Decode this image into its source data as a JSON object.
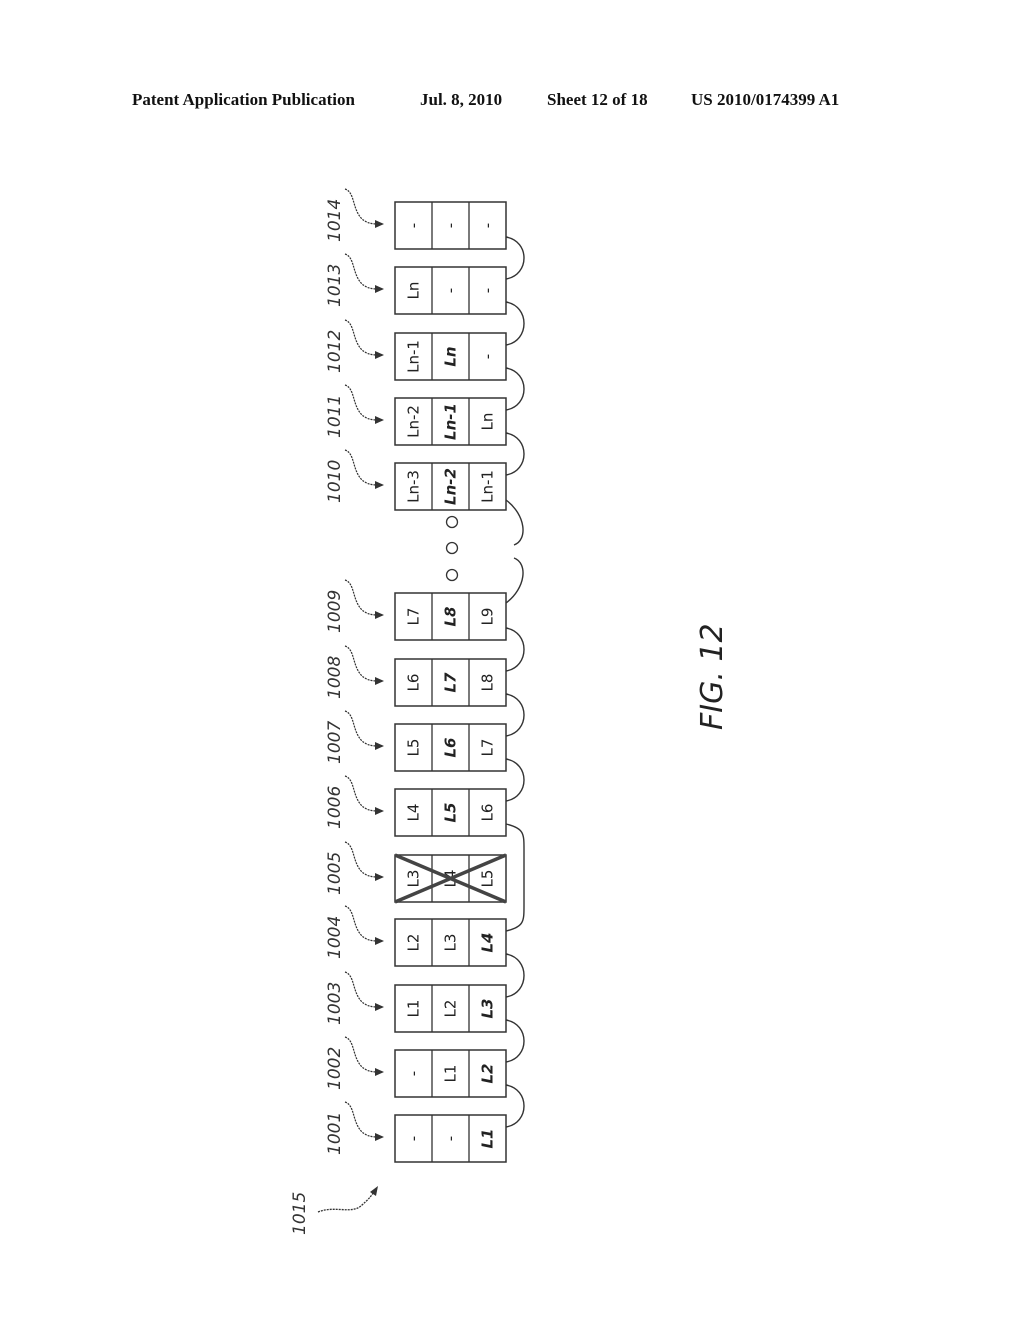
{
  "header": {
    "publication": "Patent Application Publication",
    "date": "Jul. 8, 2010",
    "sheet": "Sheet 12 of 18",
    "number": "US 2010/0174399 A1"
  },
  "figure": {
    "label": "FIG. 12",
    "sequence_label": "1015",
    "ellipsis": "o o o",
    "buffers": [
      {
        "ref": "1001",
        "cells": [
          "-",
          "-",
          "L1"
        ],
        "emphasized": [
          2
        ],
        "crossed": false
      },
      {
        "ref": "1002",
        "cells": [
          "-",
          "L1",
          "L2"
        ],
        "emphasized": [
          2
        ],
        "crossed": false
      },
      {
        "ref": "1003",
        "cells": [
          "L1",
          "L2",
          "L3"
        ],
        "emphasized": [
          2
        ],
        "crossed": false
      },
      {
        "ref": "1004",
        "cells": [
          "L2",
          "L3",
          "L4"
        ],
        "emphasized": [
          2
        ],
        "crossed": false
      },
      {
        "ref": "1005",
        "cells": [
          "L3",
          "L4",
          "L5"
        ],
        "emphasized": [],
        "crossed": true
      },
      {
        "ref": "1006",
        "cells": [
          "L4",
          "L5",
          "L6"
        ],
        "emphasized": [
          1
        ],
        "crossed": false
      },
      {
        "ref": "1007",
        "cells": [
          "L5",
          "L6",
          "L7"
        ],
        "emphasized": [
          1
        ],
        "crossed": false
      },
      {
        "ref": "1008",
        "cells": [
          "L6",
          "L7",
          "L8"
        ],
        "emphasized": [
          1
        ],
        "crossed": false
      },
      {
        "ref": "1009",
        "cells": [
          "L7",
          "L8",
          "L9"
        ],
        "emphasized": [
          1
        ],
        "crossed": false
      },
      {
        "ref": "1010",
        "cells": [
          "Ln-3",
          "Ln-2",
          "Ln-1"
        ],
        "emphasized": [
          1
        ],
        "crossed": false
      },
      {
        "ref": "1011",
        "cells": [
          "Ln-2",
          "Ln-1",
          "Ln"
        ],
        "emphasized": [
          1
        ],
        "crossed": false
      },
      {
        "ref": "1012",
        "cells": [
          "Ln-1",
          "Ln",
          "-"
        ],
        "emphasized": [
          1
        ],
        "crossed": false
      },
      {
        "ref": "1013",
        "cells": [
          "Ln",
          "-",
          "-"
        ],
        "emphasized": [],
        "crossed": false
      },
      {
        "ref": "1014",
        "cells": [
          "-",
          "-",
          "-"
        ],
        "emphasized": [],
        "crossed": false
      }
    ]
  }
}
